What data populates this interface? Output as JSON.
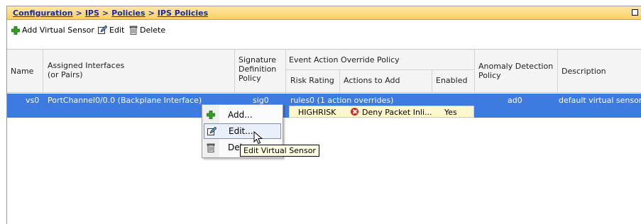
{
  "breadcrumb": {
    "items": [
      "Configuration",
      "IPS",
      "Policies",
      "IPS Policies"
    ],
    "separator": ">"
  },
  "toolbar": {
    "add_label": "Add Virtual Sensor",
    "edit_label": "Edit",
    "delete_label": "Delete"
  },
  "table": {
    "headers": {
      "name": "Name",
      "assigned_interfaces_1": "Assigned Interfaces",
      "assigned_interfaces_2": "(or Pairs)",
      "sig_def_1": "Signature",
      "sig_def_2": "Definition",
      "sig_def_3": "Policy",
      "event_action_group": "Event Action Override Policy",
      "risk_rating": "Risk Rating",
      "actions_to_add": "Actions to Add",
      "enabled": "Enabled",
      "anomaly_1": "Anomaly Detection",
      "anomaly_2": "Policy",
      "description": "Description"
    },
    "rows": [
      {
        "name": "vs0",
        "interfaces": "PortChannel0/0.0 (Backplane Interface)",
        "signature_policy": "sig0",
        "event_action_policy": "rules0 (1 action overrides)",
        "override": {
          "risk_rating": "HIGHRISK",
          "action": "Deny Packet Inli...",
          "enabled": "Yes"
        },
        "anomaly_policy": "ad0",
        "description": "default virtual sensor"
      }
    ]
  },
  "context_menu": {
    "items": [
      {
        "label": "Add...",
        "icon": "plus-icon"
      },
      {
        "label": "Edit...",
        "icon": "edit-icon"
      },
      {
        "label": "Del",
        "icon": "trash-icon"
      }
    ]
  },
  "tooltip": "Edit Virtual Sensor",
  "colors": {
    "selection": "#3d7be0",
    "title_gradient_top": "#ffe7a8",
    "title_gradient_bottom": "#fbcf63",
    "link": "#1d2a9e",
    "override_row_bg": "#fff7d0"
  }
}
